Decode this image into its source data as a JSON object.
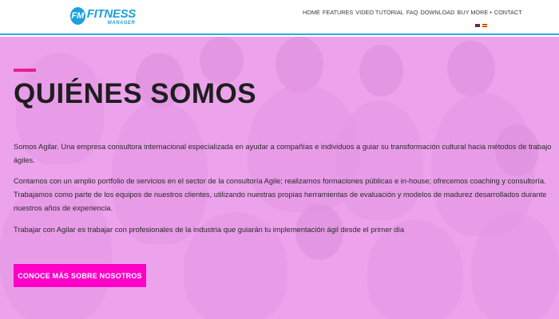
{
  "brand": {
    "badge": "FM",
    "name": "FITNESS",
    "subtitle": "MANAGER"
  },
  "nav": {
    "items": [
      "HOME",
      "FEATURES",
      "VIDEO TUTORIAL",
      "FAQ",
      "DOWNLOAD",
      "BUY MORE",
      "CONTACT"
    ]
  },
  "languages": [
    "English",
    "Español"
  ],
  "hero": {
    "title": "QUIÉNES SOMOS",
    "paragraph1": "Somos Agilar. Una empresa consultora internacional especializada en ayudar a compañías e individuos a guiar su transformación cultural hacia métodos de trabajo ágiles.",
    "paragraph2": "Contamos con un amplio portfolio de servicios en el sector de la consultoría Agile; realizamos formaciones públicas e in-house; ofrecemos coaching y consultoría. Trabajamos como parte de los equipos de nuestros clientes, utilizando nuestras propias herramientas de evaluación y modelos de madurez desarrollados durante nuestros años de experiencia.",
    "paragraph3": "Trabajar con Agilar es trabajar con profesionales de la industria que guiarán tu implementación ágil desde el primer día",
    "cta_label": "CONOCE MÁS SOBRE NOSOTROS"
  },
  "colors": {
    "brand_blue": "#1ea0dc",
    "accent_pink": "#ff00c8",
    "overlay_pink": "#e9a7e9"
  }
}
